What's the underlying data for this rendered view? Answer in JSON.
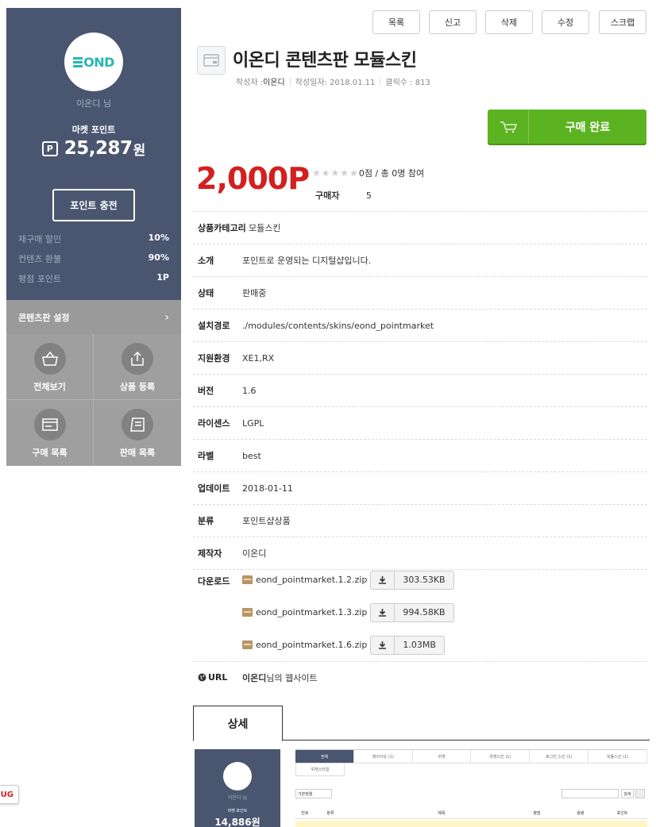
{
  "sidebar": {
    "logo_text": "OND",
    "user_name": "이온디 님",
    "market_point_label": "마켓 포인트",
    "point_badge": "P",
    "market_point_value": "25,287",
    "market_point_unit": "원",
    "charge_button": "포인트 충전",
    "stats": [
      {
        "label": "재구매 할인",
        "value": "10%"
      },
      {
        "label": "컨텐츠 환불",
        "value": "90%"
      },
      {
        "label": "평점 포인트",
        "value": "1P"
      }
    ],
    "settings_label": "콘텐츠판 설정",
    "menu": [
      {
        "label": "전체보기",
        "icon": "basket-icon"
      },
      {
        "label": "상품 등록",
        "icon": "upload-icon"
      },
      {
        "label": "구매 목록",
        "icon": "card-icon"
      },
      {
        "label": "판매 목록",
        "icon": "receipt-icon"
      }
    ]
  },
  "toolbar": {
    "list": "목록",
    "report": "신고",
    "delete": "삭제",
    "edit": "수정",
    "scrap": "스크랩"
  },
  "product": {
    "title": "이온디 콘텐츠판 모듈스킨",
    "author_label": "작성자 : ",
    "author": "이온디",
    "date": "작성일자: 2018.01.11",
    "clicks": "클릭수 : 813",
    "buy_button": "구매 완료",
    "price": "2,000P",
    "rating_text": "0점 / 총 0명 참여",
    "buyer_label": "구매자",
    "buyer_count": "5"
  },
  "info": [
    {
      "label": "상품카테고리",
      "value": "모듈스킨"
    },
    {
      "label": "소개",
      "value": "포인트로 운영되는 디지털샵입니다."
    },
    {
      "label": "상태",
      "value": "판매중"
    },
    {
      "label": "설치경로",
      "value": "./modules/contents/skins/eond_pointmarket"
    },
    {
      "label": "지원환경",
      "value": "XE1,RX"
    },
    {
      "label": "버전",
      "value": "1.6"
    },
    {
      "label": "라이센스",
      "value": "LGPL"
    },
    {
      "label": "라벨",
      "value": "best"
    },
    {
      "label": "업데이트",
      "value": "2018-01-11"
    },
    {
      "label": "분류",
      "value": "포인트샵상품"
    },
    {
      "label": "제작자",
      "value": "이온디"
    }
  ],
  "downloads": {
    "label": "다운로드",
    "files": [
      {
        "name": "eond_pointmarket.1.2.zip",
        "size": "303.53KB"
      },
      {
        "name": "eond_pointmarket.1.3.zip",
        "size": "994.58KB"
      },
      {
        "name": "eond_pointmarket.1.6.zip",
        "size": "1.03MB"
      }
    ]
  },
  "url": {
    "label": "URL",
    "owner": "이온디",
    "suffix": "님의 웹사이트"
  },
  "tabs": {
    "detail": "상세"
  },
  "preview": {
    "user_name": "이온디 님",
    "market_label": "마켓 포인트",
    "point": "14,886원",
    "tabs": [
      "전체",
      "레이아웃 (1)",
      "위젯",
      "위젯스킨 (1)",
      "로그인 스킨 (1)",
      "모듈스킨 (1)"
    ],
    "sub_tab": "위젯스타일",
    "sort": "기본정렬",
    "search_btn": "검색",
    "headers": [
      "번호",
      "분류",
      "",
      "제목",
      "평점",
      "용량",
      "포인트"
    ]
  },
  "debug_tag": "UG",
  "colors": {
    "sidebar_bg": "#4a5670",
    "sidebar_menu_bg": "#9f9f9f",
    "price_red": "#d41f1f",
    "buy_green": "#5cb321",
    "logo_teal": "#27b7b0"
  }
}
